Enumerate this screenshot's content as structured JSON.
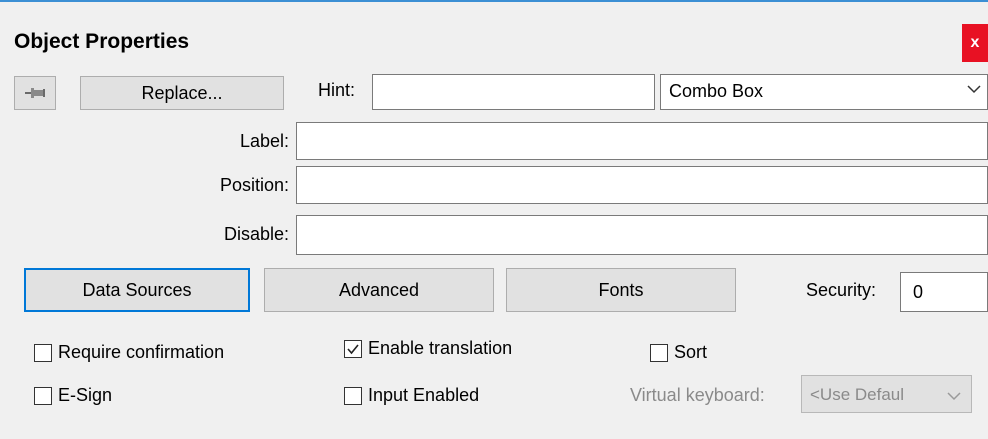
{
  "window": {
    "title": "Object Properties",
    "close_label": "x"
  },
  "toolbar": {
    "replace_label": "Replace...",
    "hint_label": "Hint:",
    "hint_value": "",
    "object_type": "Combo Box"
  },
  "fields": {
    "label_label": "Label:",
    "position_label": "Position:",
    "disable_label": "Disable:"
  },
  "tabs": {
    "data_sources": "Data Sources",
    "advanced": "Advanced",
    "fonts": "Fonts"
  },
  "security": {
    "label": "Security:",
    "value": "0"
  },
  "options": {
    "require_confirmation": {
      "label": "Require confirmation",
      "checked": false
    },
    "enable_translation": {
      "label": "Enable translation",
      "checked": true
    },
    "sort": {
      "label": "Sort",
      "checked": false
    },
    "esign": {
      "label": "E-Sign",
      "checked": false
    },
    "input_enabled": {
      "label": "Input Enabled",
      "checked": false
    }
  },
  "virtual_keyboard": {
    "label": "Virtual keyboard:",
    "value": "<Use Defaul"
  },
  "icons": {
    "pin": "pin-icon",
    "close": "close-icon",
    "chevron": "chevron-down-icon",
    "check": "check-icon"
  }
}
